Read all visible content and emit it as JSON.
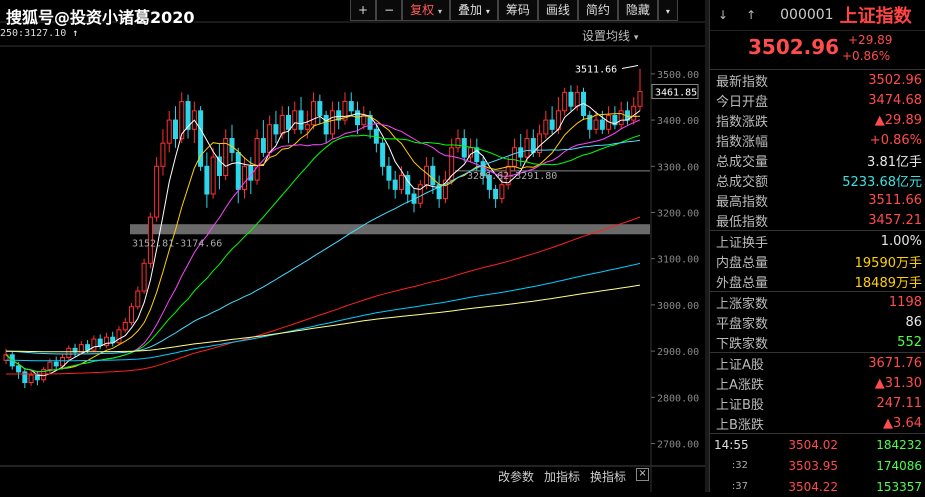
{
  "watermark": "搜狐号@投资小诸葛2020",
  "toolbar": {
    "plus": "+",
    "minus": "−",
    "fuquan": "复权",
    "diejia": "叠加",
    "choumа": "筹码",
    "huaxian": "画线",
    "jianyue": "简约",
    "yincang": "隐藏"
  },
  "ma_info": "250:3127.10",
  "ma_setting": "设置均线",
  "bottom": {
    "gai": "改参数",
    "jia": "加指标",
    "huan": "换指标",
    "close": "×"
  },
  "annotations": {
    "high": "3511.66",
    "current": "3461.85",
    "mid": "3286.62-3291.80",
    "low": "3152.81-3174.66"
  },
  "chart_data": {
    "type": "candlestick",
    "y_axis_ticks": [
      "3500.00",
      "3400.00",
      "3300.00",
      "3200.00",
      "3100.00",
      "3000.00",
      "2900.00",
      "2800.00",
      "2700.00"
    ],
    "ylim": [
      2660,
      3530
    ],
    "candles": [
      [
        2880,
        2892,
        2905,
        2872
      ],
      [
        2892,
        2868,
        2898,
        2860
      ],
      [
        2868,
        2855,
        2876,
        2840
      ],
      [
        2855,
        2832,
        2862,
        2820
      ],
      [
        2832,
        2848,
        2858,
        2825
      ],
      [
        2848,
        2838,
        2856,
        2826
      ],
      [
        2838,
        2860,
        2866,
        2832
      ],
      [
        2860,
        2876,
        2884,
        2850
      ],
      [
        2876,
        2868,
        2888,
        2858
      ],
      [
        2868,
        2886,
        2894,
        2860
      ],
      [
        2886,
        2906,
        2912,
        2878
      ],
      [
        2906,
        2898,
        2916,
        2888
      ],
      [
        2898,
        2914,
        2922,
        2892
      ],
      [
        2914,
        2902,
        2924,
        2896
      ],
      [
        2902,
        2926,
        2934,
        2898
      ],
      [
        2926,
        2912,
        2936,
        2904
      ],
      [
        2912,
        2930,
        2940,
        2906
      ],
      [
        2930,
        2918,
        2942,
        2910
      ],
      [
        2918,
        2946,
        2954,
        2914
      ],
      [
        2946,
        2962,
        2972,
        2940
      ],
      [
        2962,
        2996,
        3004,
        2956
      ],
      [
        2996,
        3030,
        3040,
        2990
      ],
      [
        3030,
        3090,
        3100,
        3024
      ],
      [
        3090,
        3190,
        3200,
        3080
      ],
      [
        3190,
        3300,
        3320,
        3180
      ],
      [
        3300,
        3350,
        3380,
        3280
      ],
      [
        3350,
        3400,
        3420,
        3330
      ],
      [
        3400,
        3360,
        3430,
        3340
      ],
      [
        3360,
        3440,
        3460,
        3350
      ],
      [
        3440,
        3380,
        3455,
        3360
      ],
      [
        3380,
        3420,
        3440,
        3350
      ],
      [
        3420,
        3300,
        3430,
        3290
      ],
      [
        3300,
        3240,
        3330,
        3210
      ],
      [
        3240,
        3320,
        3340,
        3230
      ],
      [
        3320,
        3280,
        3350,
        3250
      ],
      [
        3280,
        3360,
        3380,
        3270
      ],
      [
        3360,
        3330,
        3390,
        3310
      ],
      [
        3330,
        3250,
        3340,
        3220
      ],
      [
        3250,
        3300,
        3320,
        3230
      ],
      [
        3300,
        3270,
        3320,
        3240
      ],
      [
        3270,
        3360,
        3380,
        3260
      ],
      [
        3360,
        3330,
        3400,
        3320
      ],
      [
        3330,
        3390,
        3410,
        3320
      ],
      [
        3390,
        3370,
        3420,
        3350
      ],
      [
        3370,
        3410,
        3430,
        3360
      ],
      [
        3410,
        3380,
        3430,
        3350
      ],
      [
        3380,
        3420,
        3440,
        3370
      ],
      [
        3420,
        3380,
        3450,
        3370
      ],
      [
        3380,
        3390,
        3420,
        3360
      ],
      [
        3390,
        3440,
        3460,
        3380
      ],
      [
        3440,
        3410,
        3455,
        3390
      ],
      [
        3410,
        3370,
        3420,
        3350
      ],
      [
        3370,
        3420,
        3440,
        3360
      ],
      [
        3420,
        3400,
        3440,
        3380
      ],
      [
        3400,
        3440,
        3460,
        3390
      ],
      [
        3440,
        3420,
        3460,
        3410
      ],
      [
        3420,
        3390,
        3440,
        3370
      ],
      [
        3390,
        3410,
        3430,
        3380
      ],
      [
        3410,
        3380,
        3420,
        3360
      ],
      [
        3380,
        3350,
        3390,
        3330
      ],
      [
        3350,
        3300,
        3360,
        3280
      ],
      [
        3300,
        3270,
        3320,
        3250
      ],
      [
        3270,
        3250,
        3290,
        3230
      ],
      [
        3250,
        3280,
        3300,
        3240
      ],
      [
        3280,
        3240,
        3290,
        3220
      ],
      [
        3240,
        3220,
        3250,
        3200
      ],
      [
        3220,
        3260,
        3270,
        3210
      ],
      [
        3260,
        3300,
        3320,
        3250
      ],
      [
        3300,
        3260,
        3320,
        3240
      ],
      [
        3260,
        3230,
        3280,
        3210
      ],
      [
        3230,
        3270,
        3290,
        3220
      ],
      [
        3270,
        3340,
        3360,
        3260
      ],
      [
        3340,
        3360,
        3380,
        3330
      ],
      [
        3360,
        3320,
        3380,
        3310
      ],
      [
        3320,
        3340,
        3360,
        3310
      ],
      [
        3340,
        3310,
        3360,
        3290
      ],
      [
        3310,
        3280,
        3320,
        3260
      ],
      [
        3280,
        3250,
        3290,
        3230
      ],
      [
        3250,
        3230,
        3260,
        3210
      ],
      [
        3230,
        3260,
        3290,
        3220
      ],
      [
        3260,
        3300,
        3320,
        3250
      ],
      [
        3300,
        3340,
        3360,
        3290
      ],
      [
        3340,
        3320,
        3370,
        3300
      ],
      [
        3320,
        3360,
        3380,
        3310
      ],
      [
        3360,
        3330,
        3380,
        3320
      ],
      [
        3330,
        3370,
        3390,
        3320
      ],
      [
        3370,
        3400,
        3420,
        3360
      ],
      [
        3400,
        3380,
        3430,
        3370
      ],
      [
        3380,
        3420,
        3450,
        3370
      ],
      [
        3420,
        3460,
        3470,
        3410
      ],
      [
        3460,
        3430,
        3475,
        3420
      ],
      [
        3430,
        3460,
        3475,
        3420
      ],
      [
        3460,
        3410,
        3470,
        3400
      ],
      [
        3410,
        3380,
        3420,
        3360
      ],
      [
        3380,
        3400,
        3420,
        3370
      ],
      [
        3400,
        3380,
        3420,
        3370
      ],
      [
        3380,
        3410,
        3430,
        3370
      ],
      [
        3410,
        3390,
        3430,
        3380
      ],
      [
        3390,
        3420,
        3440,
        3380
      ],
      [
        3420,
        3400,
        3440,
        3390
      ],
      [
        3400,
        3430,
        3450,
        3390
      ],
      [
        3430,
        3462,
        3511,
        3420
      ]
    ],
    "ma_colors": [
      "#ffffff",
      "#ffd000",
      "#ff44ff",
      "#00ff00",
      "#44ddff",
      "#ff2020",
      "#00ccff",
      "#ffff88"
    ],
    "colors": {
      "up": "#ff3030",
      "down": "#2dd6e8",
      "band": "#6a6a6a"
    }
  },
  "panel": {
    "code": "000001",
    "name": "上证指数",
    "price": "3502.96",
    "change": "+29.89",
    "change_pct": "+0.86%",
    "stats": [
      {
        "label": "最新指数",
        "value": "3502.96",
        "cls": "red"
      },
      {
        "label": "今日开盘",
        "value": "3474.68",
        "cls": "red"
      },
      {
        "label": "指数涨跌",
        "value": "▲29.89",
        "cls": "red"
      },
      {
        "label": "指数涨幅",
        "value": "+0.86%",
        "cls": "red"
      },
      {
        "label": "总成交量",
        "value": "3.81亿手",
        "cls": "wh"
      },
      {
        "label": "总成交额",
        "value": "5233.68亿元",
        "cls": "cy"
      },
      {
        "label": "最高指数",
        "value": "3511.66",
        "cls": "red"
      },
      {
        "label": "最低指数",
        "value": "3457.21",
        "cls": "red"
      }
    ],
    "stats2": [
      {
        "label": "上证换手",
        "value": "1.00%",
        "cls": "wh"
      },
      {
        "label": "内盘总量",
        "value": "19590万手",
        "cls": "yl"
      },
      {
        "label": "外盘总量",
        "value": "18489万手",
        "cls": "yl"
      }
    ],
    "stats3": [
      {
        "label": "上涨家数",
        "value": "1198",
        "cls": "red"
      },
      {
        "label": "平盘家数",
        "value": "86",
        "cls": "wh"
      },
      {
        "label": "下跌家数",
        "value": "552",
        "cls": "gr"
      }
    ],
    "stats4": [
      {
        "label": "上证A股",
        "value": "3671.76",
        "cls": "red"
      },
      {
        "label": "上A涨跌",
        "value": "▲31.30",
        "cls": "red"
      },
      {
        "label": "上证B股",
        "value": "247.11",
        "cls": "red"
      },
      {
        "label": "上B涨跌",
        "value": "▲3.64",
        "cls": "red"
      }
    ],
    "ticks": [
      {
        "time": "14:55",
        "price": "3504.02",
        "vol": "184232"
      },
      {
        "time": ":32",
        "price": "3503.95",
        "vol": "174086"
      },
      {
        "time": ":37",
        "price": "3504.22",
        "vol": "153357"
      }
    ]
  }
}
